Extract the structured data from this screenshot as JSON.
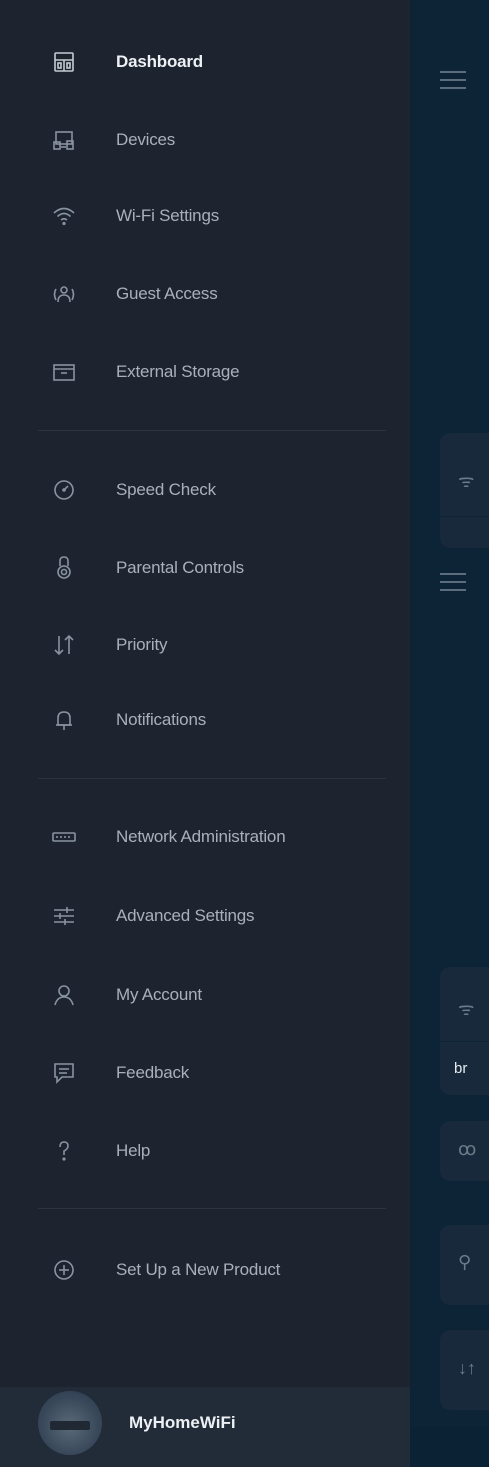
{
  "menu": {
    "items": [
      {
        "label": "Dashboard",
        "icon": "dashboard-icon"
      },
      {
        "label": "Devices",
        "icon": "devices-icon"
      },
      {
        "label": "Wi-Fi Settings",
        "icon": "wifi-icon"
      },
      {
        "label": "Guest Access",
        "icon": "guest-access-icon"
      },
      {
        "label": "External Storage",
        "icon": "storage-icon"
      },
      {
        "label": "Speed Check",
        "icon": "speedometer-icon"
      },
      {
        "label": "Parental Controls",
        "icon": "parental-lock-icon"
      },
      {
        "label": "Priority",
        "icon": "priority-arrows-icon"
      },
      {
        "label": "Notifications",
        "icon": "bell-icon"
      },
      {
        "label": "Network Administration",
        "icon": "router-icon"
      },
      {
        "label": "Advanced Settings",
        "icon": "sliders-icon"
      },
      {
        "label": "My Account",
        "icon": "user-icon"
      },
      {
        "label": "Feedback",
        "icon": "feedback-icon"
      },
      {
        "label": "Help",
        "icon": "help-icon"
      },
      {
        "label": "Set Up a New Product",
        "icon": "add-circle-icon"
      }
    ]
  },
  "footer": {
    "network_name": "MyHomeWiFi"
  },
  "background": {
    "card_text": "br"
  },
  "colors": {
    "drawer_bg": "#1d2430",
    "page_bg": "#0b2134",
    "active_text": "#eef1f4",
    "text": "#a9b0b9"
  }
}
